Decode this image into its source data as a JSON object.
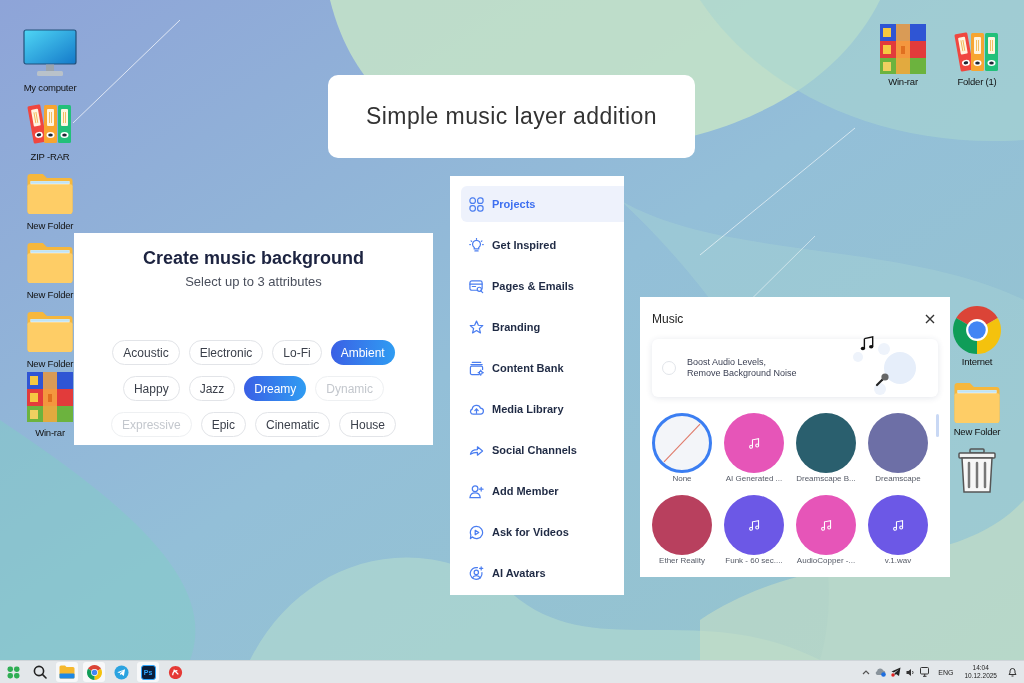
{
  "title_card": {
    "text": "Simple music layer addition"
  },
  "desktop_left": [
    {
      "kind": "monitor",
      "label": "My computer"
    },
    {
      "kind": "binders",
      "label": "ZIP -RAR"
    },
    {
      "kind": "folder",
      "label": "New Folder"
    },
    {
      "kind": "folder",
      "label": "New Folder"
    },
    {
      "kind": "folder",
      "label": "New Folder"
    },
    {
      "kind": "archive",
      "label": "Win-rar"
    }
  ],
  "desktop_top_right": [
    {
      "kind": "archive",
      "label": "Win-rar"
    },
    {
      "kind": "binders",
      "label": "Folder (1)"
    }
  ],
  "desktop_right": [
    {
      "kind": "browser",
      "label": "Internet"
    },
    {
      "kind": "folder",
      "label": "New Folder"
    },
    {
      "kind": "trash"
    }
  ],
  "attributes_panel": {
    "title": "Create music background",
    "subtitle": "Select up to 3 attributes",
    "chip_rows": [
      [
        {
          "label": "Acoustic",
          "selected": false,
          "disabled": false
        },
        {
          "label": "Electronic",
          "selected": false,
          "disabled": false
        },
        {
          "label": "Lo-Fi",
          "selected": false,
          "disabled": false
        },
        {
          "label": "Ambient",
          "selected": true,
          "disabled": false
        }
      ],
      [
        {
          "label": "Happy",
          "selected": false,
          "disabled": false
        },
        {
          "label": "Jazz",
          "selected": false,
          "disabled": false
        },
        {
          "label": "Dreamy",
          "selected": true,
          "disabled": false
        },
        {
          "label": "Dynamic",
          "selected": false,
          "disabled": true
        }
      ],
      [
        {
          "label": "Expressive",
          "selected": false,
          "disabled": true
        },
        {
          "label": "Epic",
          "selected": false,
          "disabled": false
        },
        {
          "label": "Cinematic",
          "selected": false,
          "disabled": false
        },
        {
          "label": "House",
          "selected": false,
          "disabled": false
        }
      ]
    ]
  },
  "sidebar": {
    "items": [
      {
        "kind": "grid",
        "label": "Projects",
        "selected": true
      },
      {
        "kind": "bulb",
        "label": "Get Inspired",
        "selected": false
      },
      {
        "kind": "pages",
        "label": "Pages & Emails",
        "selected": false
      },
      {
        "kind": "star",
        "label": "Branding",
        "selected": false
      },
      {
        "kind": "bank",
        "label": "Content Bank",
        "selected": false
      },
      {
        "kind": "cloud",
        "label": "Media Library",
        "selected": false
      },
      {
        "kind": "share",
        "label": "Social Channels",
        "selected": false
      },
      {
        "kind": "member",
        "label": "Add Member",
        "selected": false
      },
      {
        "kind": "video",
        "label": "Ask for Videos",
        "selected": false
      },
      {
        "kind": "avatar",
        "label": "AI Avatars",
        "selected": false
      }
    ]
  },
  "music_panel": {
    "title": "Music",
    "banner": {
      "checked": false,
      "lines": [
        "Boost Audio Levels,",
        "Remove Background Noise"
      ]
    },
    "tracks": [
      {
        "kind": "none",
        "label": "None",
        "selected": true
      },
      {
        "kind": "note",
        "label": "AI Generated ...",
        "color": "#e655b8",
        "selected": false
      },
      {
        "kind": "photo",
        "label": "Dreamscape B...",
        "color": "#2a5f6e",
        "selected": false
      },
      {
        "kind": "photo",
        "label": "Dreamscape",
        "color": "#6d6fa6",
        "selected": false
      },
      {
        "kind": "photo",
        "label": "Ether Reality",
        "color": "#b8405e",
        "selected": false
      },
      {
        "kind": "note",
        "label": "Funk - 60 sec....",
        "color": "#6c58e6",
        "selected": false
      },
      {
        "kind": "note",
        "label": "AudioCopper -...",
        "color": "#e655b8",
        "selected": false
      },
      {
        "kind": "note",
        "label": "v.1.wav",
        "color": "#6c58e6",
        "selected": false
      }
    ]
  },
  "taskbar": {
    "apps": [
      {
        "kind": "start",
        "active": false
      },
      {
        "kind": "search",
        "active": false
      },
      {
        "kind": "files",
        "active": true
      },
      {
        "kind": "browser",
        "active": true
      },
      {
        "kind": "messenger",
        "active": false
      },
      {
        "kind": "photo_editor",
        "active": true,
        "logo_text": "Ps"
      },
      {
        "kind": "app",
        "active": false
      }
    ],
    "tray": {
      "language": "ENG",
      "time": "14:04",
      "date": "10.12.2025"
    }
  }
}
